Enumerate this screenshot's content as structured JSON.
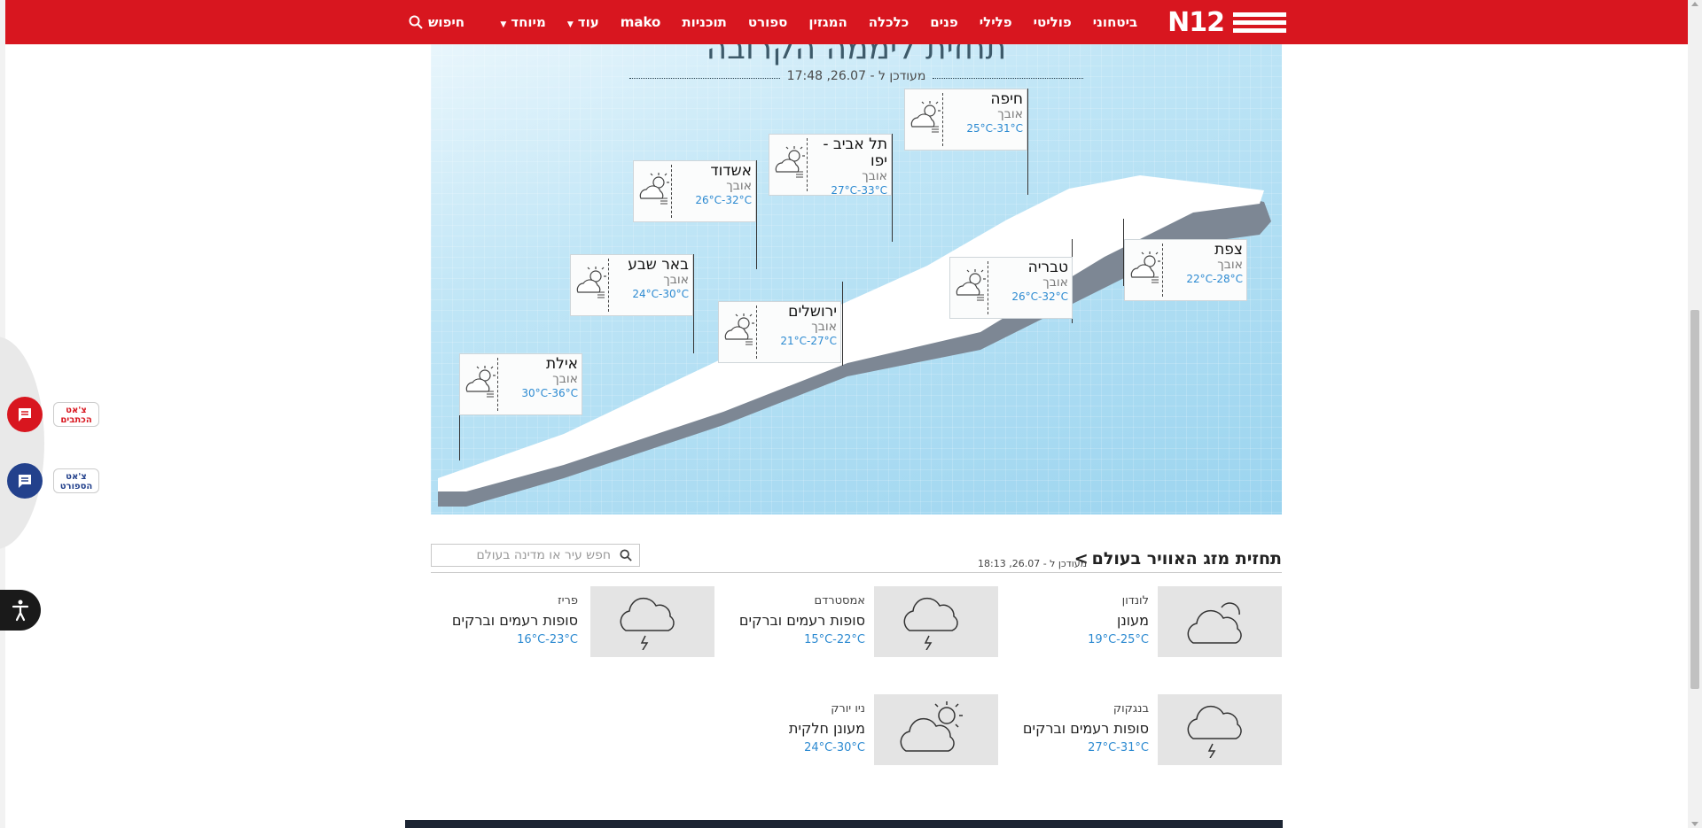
{
  "nav": {
    "logo": "N12",
    "items": [
      "ביטחוני",
      "פוליטי",
      "פלילי",
      "פנים",
      "כלכלה",
      "המגזין",
      "ספורט",
      "תוכניות",
      "mako",
      "עוד",
      "מיוחד"
    ],
    "search_label": "חיפוש"
  },
  "forecast": {
    "title": "תחזית ליממה הקרובה",
    "updated": "מעודכן ל - 26.07, 17:48",
    "cities": [
      {
        "name": "חיפה",
        "desc": "אובך",
        "temp": "25°C-31°C"
      },
      {
        "name": "תל אביב - יפו",
        "desc": "אובך",
        "temp": "27°C-33°C"
      },
      {
        "name": "אשדוד",
        "desc": "אובך",
        "temp": "26°C-32°C"
      },
      {
        "name": "באר שבע",
        "desc": "אובך",
        "temp": "24°C-30°C"
      },
      {
        "name": "ירושלים",
        "desc": "אובך",
        "temp": "21°C-27°C"
      },
      {
        "name": "טבריה",
        "desc": "אובך",
        "temp": "26°C-32°C"
      },
      {
        "name": "צפת",
        "desc": "אובך",
        "temp": "22°C-28°C"
      },
      {
        "name": "אילת",
        "desc": "אובך",
        "temp": "30°C-36°C"
      }
    ]
  },
  "world": {
    "title": "תחזית מזג האוויר בעולם",
    "arrow": ">",
    "updated": "מעודכן ל - 26.07, 18:13",
    "search_placeholder": "חפש עיר או מדינה בעולם",
    "cities": [
      {
        "name": "לונדון",
        "desc": "מעונן",
        "temp": "19°C-25°C",
        "icon": "cloudy-icon"
      },
      {
        "name": "אמסטרדם",
        "desc": "סופות רעמים וברקים",
        "temp": "15°C-22°C",
        "icon": "thunderstorm-icon"
      },
      {
        "name": "פריז",
        "desc": "סופות רעמים וברקים",
        "temp": "16°C-23°C",
        "icon": "thunderstorm-icon"
      },
      {
        "name": "בנגקוק",
        "desc": "סופות רעמים וברקים",
        "temp": "27°C-31°C",
        "icon": "thunderstorm-icon"
      },
      {
        "name": "ניו יורק",
        "desc": "מעונן חלקית",
        "temp": "24°C-30°C",
        "icon": "partly-cloudy-icon"
      }
    ]
  },
  "side": {
    "chat_news_line1": "צ'אט",
    "chat_news_line2": "הכתבים",
    "chat_sport_line1": "צ'אט",
    "chat_sport_line2": "הספורט"
  },
  "colors": {
    "brand_red": "#d8161f",
    "temp_blue": "#2c8ad1",
    "sport_blue": "#23418c"
  }
}
